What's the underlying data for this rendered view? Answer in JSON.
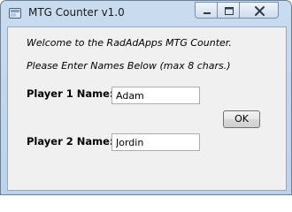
{
  "window": {
    "title": "MTG Counter v1.0"
  },
  "intro": {
    "welcome": "Welcome to the RadAdApps MTG Counter.",
    "instructions": "Please Enter Names Below (max 8 chars.)"
  },
  "player1": {
    "label": "Player 1 Name:",
    "value": "Adam"
  },
  "player2": {
    "label": "Player 2 Name:",
    "value": "Jordin"
  },
  "ok_button": {
    "label": "OK"
  },
  "icons": {
    "app": "app-window-icon",
    "minimize": "minimize-icon",
    "maximize": "maximize-icon",
    "close": "close-icon"
  }
}
